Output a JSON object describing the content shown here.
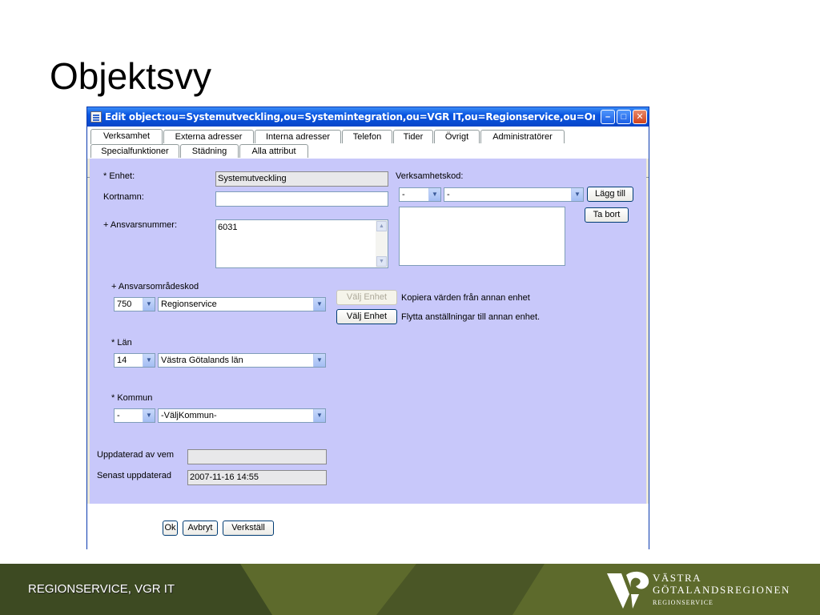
{
  "slide": {
    "title": "Objektsvy",
    "footer_text": "REGIONSERVICE, VGR IT",
    "logo": {
      "line1": "VÄSTRA",
      "line2": "GÖTALANDSREGIONEN",
      "line3": "REGIONSERVICE"
    }
  },
  "window": {
    "title": "Edit object:ou=Systemutveckling,ou=Systemintegration,ou=VGR IT,ou=Regionservice,ou=Org,o=VGR - Microsoft ...",
    "minimize": "–",
    "maximize": "□",
    "close": "✕",
    "tabs_row1": [
      "Verksamhet",
      "Externa adresser",
      "Interna adresser",
      "Telefon",
      "Tider",
      "Övrigt",
      "Administratörer"
    ],
    "tabs_row2": [
      "Specialfunktioner",
      "Städning",
      "Alla attribut"
    ],
    "active_tab": "Verksamhet"
  },
  "form": {
    "enhet_label": "* Enhet:",
    "enhet_value": "Systemutveckling",
    "kortnamn_label": "Kortnamn:",
    "kortnamn_value": "",
    "ansvarsnummer_label": "+ Ansvarsnummer:",
    "ansvarsnummer_value": "6031",
    "verksamhetskod_label": "Verksamhetskod:",
    "verksamhetskod_select1": "-",
    "verksamhetskod_select2": "-",
    "lagg_till": "Lägg till",
    "ta_bort": "Ta bort",
    "ansvarsomradeskod_label": "+ Ansvarsområdeskod",
    "ansvarsomradeskod_code": "750",
    "ansvarsomradeskod_name": "Regionservice",
    "valj_enhet_1": "Välj Enhet",
    "valj_enhet_1_desc": "Kopiera värden från annan enhet",
    "valj_enhet_2": "Välj Enhet",
    "valj_enhet_2_desc": "Flytta anställningar till annan enhet.",
    "lan_label": "* Län",
    "lan_code": "14",
    "lan_name": "Västra Götalands län",
    "kommun_label": "* Kommun",
    "kommun_code": "-",
    "kommun_name": "-VäljKommun-",
    "uppdaterad_label": "Uppdaterad av vem",
    "uppdaterad_value": "",
    "senast_label": "Senast uppdaterad",
    "senast_value": "2007-11-16 14:55"
  },
  "buttons": {
    "ok": "Ok",
    "avbryt": "Avbryt",
    "verkstall": "Verkställ"
  },
  "colors": {
    "panel": "#c8c8fa",
    "titlebar": "#0a55e0",
    "footer": "#5d6a2c"
  }
}
